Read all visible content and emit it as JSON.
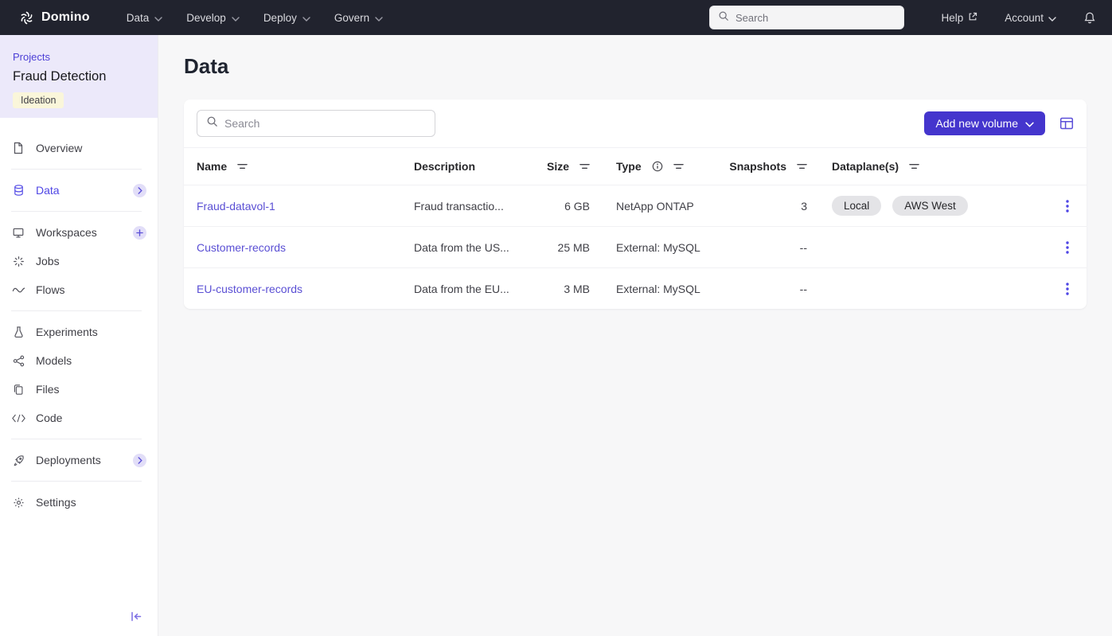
{
  "topbar": {
    "brand": "Domino",
    "nav": [
      {
        "label": "Data"
      },
      {
        "label": "Develop"
      },
      {
        "label": "Deploy"
      },
      {
        "label": "Govern"
      }
    ],
    "search_placeholder": "Search",
    "help_label": "Help",
    "account_label": "Account"
  },
  "sidebar": {
    "eyebrow": "Projects",
    "project_name": "Fraud Detection",
    "stage_badge": "Ideation",
    "items": [
      {
        "label": "Overview"
      },
      {
        "label": "Data"
      },
      {
        "label": "Workspaces"
      },
      {
        "label": "Jobs"
      },
      {
        "label": "Flows"
      },
      {
        "label": "Experiments"
      },
      {
        "label": "Models"
      },
      {
        "label": "Files"
      },
      {
        "label": "Code"
      },
      {
        "label": "Deployments"
      },
      {
        "label": "Settings"
      }
    ]
  },
  "main": {
    "title": "Data",
    "toolbar": {
      "search_placeholder": "Search",
      "add_button_label": "Add new volume"
    },
    "table": {
      "columns": [
        {
          "label": "Name"
        },
        {
          "label": "Description"
        },
        {
          "label": "Size"
        },
        {
          "label": "Type"
        },
        {
          "label": "Snapshots"
        },
        {
          "label": "Dataplane(s)"
        }
      ],
      "rows": [
        {
          "name": "Fraud-datavol-1",
          "description": "Fraud transactio...",
          "size": "6 GB",
          "type": "NetApp ONTAP",
          "snapshots": "3",
          "dataplanes": [
            "Local",
            "AWS West"
          ]
        },
        {
          "name": "Customer-records",
          "description": "Data from the US...",
          "size": "25 MB",
          "type": "External: MySQL",
          "snapshots": "--",
          "dataplanes": []
        },
        {
          "name": "EU-customer-records",
          "description": "Data from the EU...",
          "size": "3 MB",
          "type": "External: MySQL",
          "snapshots": "--",
          "dataplanes": []
        }
      ]
    }
  },
  "colors": {
    "accent": "#4f46e5",
    "primary_button": "#4435cd",
    "topbar_bg": "#21232e",
    "sidebar_header_bg": "#ece9fa",
    "stage_badge_bg": "#faf6da",
    "pill_bg": "#e4e4e7",
    "page_bg": "#f7f7f8",
    "link": "#5a4fd4"
  }
}
